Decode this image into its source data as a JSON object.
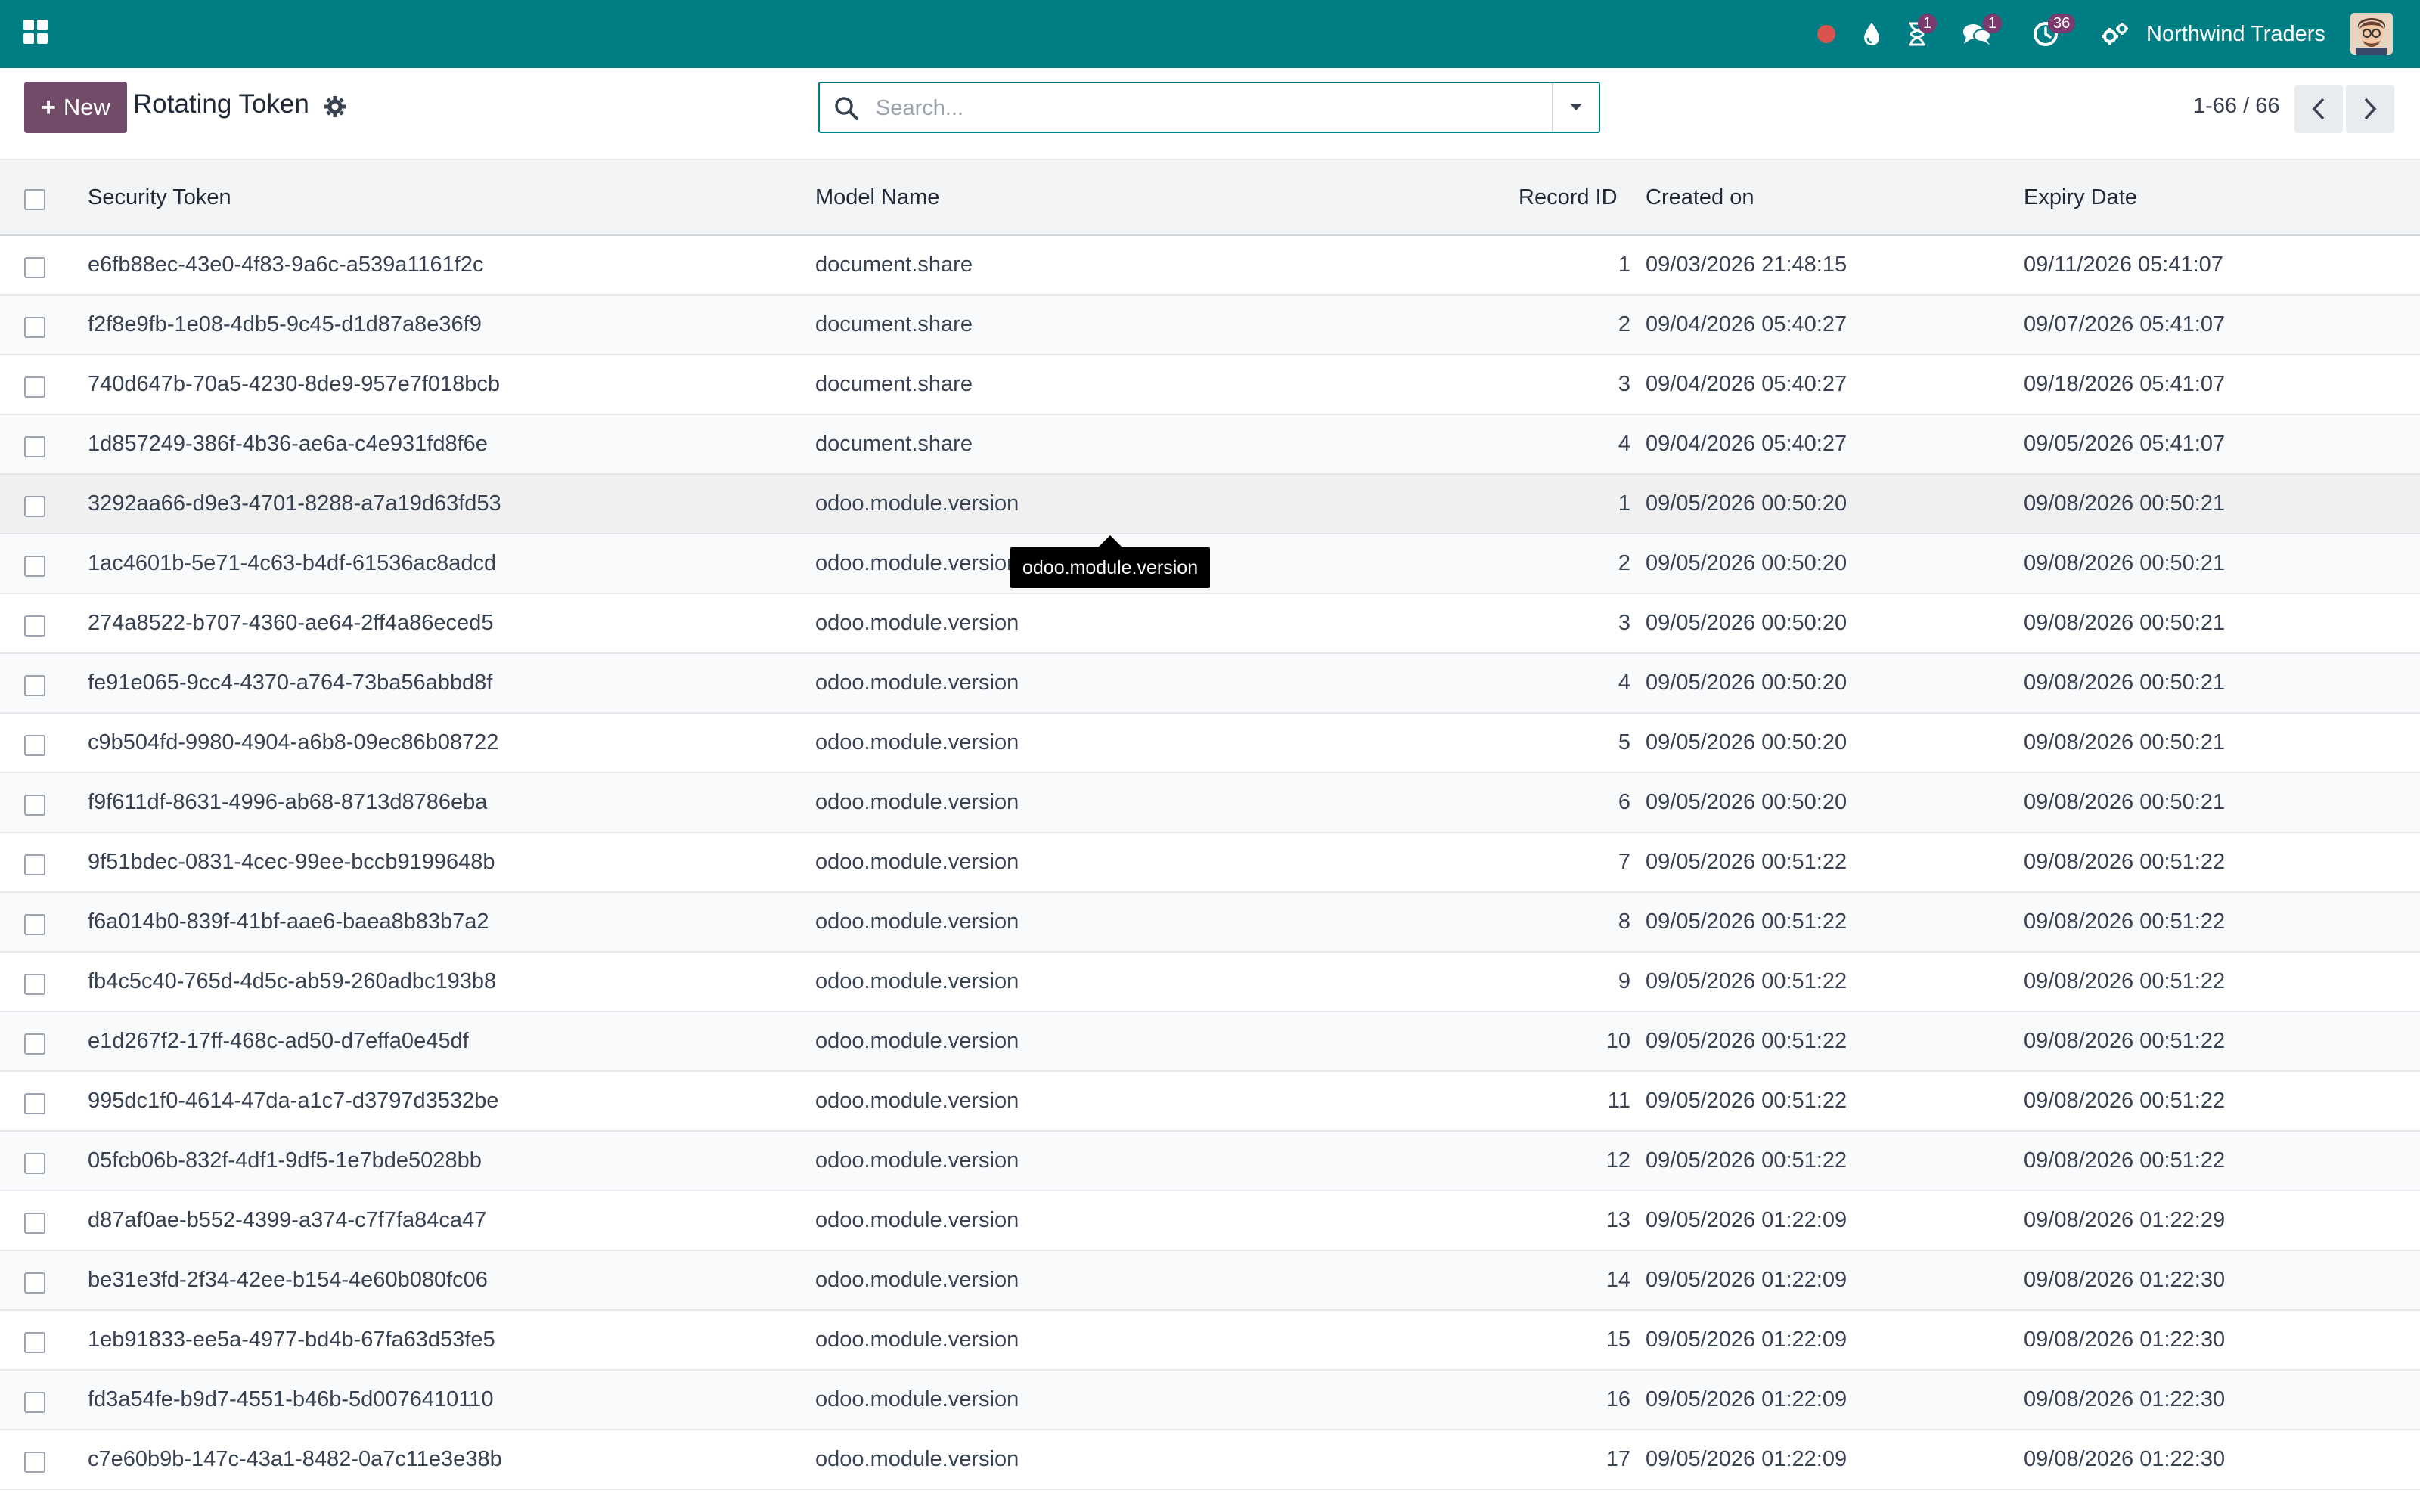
{
  "navbar": {
    "company_name": "Northwind Traders",
    "icons": [
      "apps-grid-icon",
      "record-dot-icon",
      "droplet-icon",
      "hourglass-icon",
      "chat-bubbles-icon",
      "activity-clock-icon",
      "gears-icon"
    ],
    "badges": {
      "hourglass": "1",
      "messages": "1",
      "activities": "36"
    },
    "colors": {
      "navbar": "#017e84",
      "badge": "#7a3a6d",
      "record_dot": "#d9534f"
    }
  },
  "control_panel": {
    "new_button_label": "New",
    "title": "Rotating Token",
    "search_placeholder": "Search...",
    "pager": "1-66 / 66",
    "colors": {
      "primary_button": "#714b67"
    }
  },
  "table": {
    "columns": [
      "Security Token",
      "Model Name",
      "Record ID",
      "Created on",
      "Expiry Date"
    ],
    "rows": [
      [
        "e6fb88ec-43e0-4f83-9a6c-a539a1161f2c",
        "document.share",
        "1",
        "09/03/2026 21:48:15",
        "09/11/2026 05:41:07"
      ],
      [
        "f2f8e9fb-1e08-4db5-9c45-d1d87a8e36f9",
        "document.share",
        "2",
        "09/04/2026 05:40:27",
        "09/07/2026 05:41:07"
      ],
      [
        "740d647b-70a5-4230-8de9-957e7f018bcb",
        "document.share",
        "3",
        "09/04/2026 05:40:27",
        "09/18/2026 05:41:07"
      ],
      [
        "1d857249-386f-4b36-ae6a-c4e931fd8f6e",
        "document.share",
        "4",
        "09/04/2026 05:40:27",
        "09/05/2026 05:41:07"
      ],
      [
        "3292aa66-d9e3-4701-8288-a7a19d63fd53",
        "odoo.module.version",
        "1",
        "09/05/2026 00:50:20",
        "09/08/2026 00:50:21"
      ],
      [
        "1ac4601b-5e71-4c63-b4df-61536ac8adcd",
        "odoo.module.version",
        "2",
        "09/05/2026 00:50:20",
        "09/08/2026 00:50:21"
      ],
      [
        "274a8522-b707-4360-ae64-2ff4a86eced5",
        "odoo.module.version",
        "3",
        "09/05/2026 00:50:20",
        "09/08/2026 00:50:21"
      ],
      [
        "fe91e065-9cc4-4370-a764-73ba56abbd8f",
        "odoo.module.version",
        "4",
        "09/05/2026 00:50:20",
        "09/08/2026 00:50:21"
      ],
      [
        "c9b504fd-9980-4904-a6b8-09ec86b08722",
        "odoo.module.version",
        "5",
        "09/05/2026 00:50:20",
        "09/08/2026 00:50:21"
      ],
      [
        "f9f611df-8631-4996-ab68-8713d8786eba",
        "odoo.module.version",
        "6",
        "09/05/2026 00:50:20",
        "09/08/2026 00:50:21"
      ],
      [
        "9f51bdec-0831-4cec-99ee-bccb9199648b",
        "odoo.module.version",
        "7",
        "09/05/2026 00:51:22",
        "09/08/2026 00:51:22"
      ],
      [
        "f6a014b0-839f-41bf-aae6-baea8b83b7a2",
        "odoo.module.version",
        "8",
        "09/05/2026 00:51:22",
        "09/08/2026 00:51:22"
      ],
      [
        "fb4c5c40-765d-4d5c-ab59-260adbc193b8",
        "odoo.module.version",
        "9",
        "09/05/2026 00:51:22",
        "09/08/2026 00:51:22"
      ],
      [
        "e1d267f2-17ff-468c-ad50-d7effa0e45df",
        "odoo.module.version",
        "10",
        "09/05/2026 00:51:22",
        "09/08/2026 00:51:22"
      ],
      [
        "995dc1f0-4614-47da-a1c7-d3797d3532be",
        "odoo.module.version",
        "11",
        "09/05/2026 00:51:22",
        "09/08/2026 00:51:22"
      ],
      [
        "05fcb06b-832f-4df1-9df5-1e7bde5028bb",
        "odoo.module.version",
        "12",
        "09/05/2026 00:51:22",
        "09/08/2026 00:51:22"
      ],
      [
        "d87af0ae-b552-4399-a374-c7f7fa84ca47",
        "odoo.module.version",
        "13",
        "09/05/2026 01:22:09",
        "09/08/2026 01:22:29"
      ],
      [
        "be31e3fd-2f34-42ee-b154-4e60b080fc06",
        "odoo.module.version",
        "14",
        "09/05/2026 01:22:09",
        "09/08/2026 01:22:30"
      ],
      [
        "1eb91833-ee5a-4977-bd4b-67fa63d53fe5",
        "odoo.module.version",
        "15",
        "09/05/2026 01:22:09",
        "09/08/2026 01:22:30"
      ],
      [
        "fd3a54fe-b9d7-4551-b46b-5d0076410110",
        "odoo.module.version",
        "16",
        "09/05/2026 01:22:09",
        "09/08/2026 01:22:30"
      ],
      [
        "c7e60b9b-147c-43a1-8482-0a7c11e3e38b",
        "odoo.module.version",
        "17",
        "09/05/2026 01:22:09",
        "09/08/2026 01:22:30"
      ]
    ]
  },
  "tooltip": {
    "text": "odoo.module.version"
  }
}
